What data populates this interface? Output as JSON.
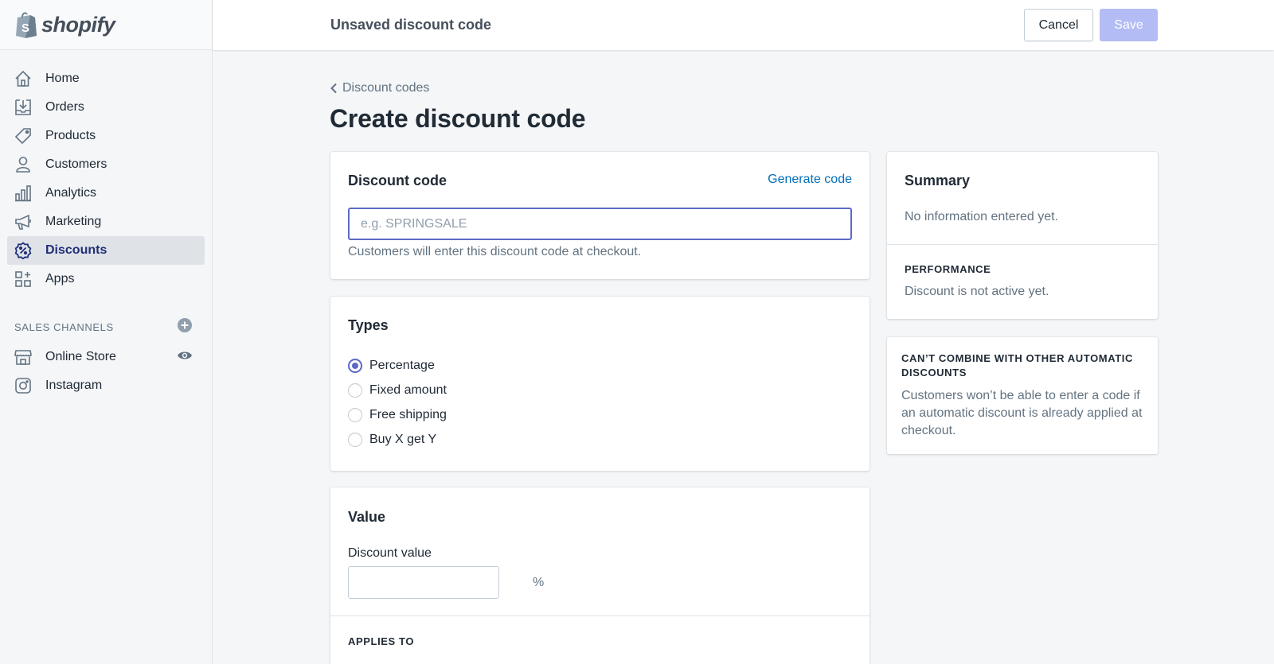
{
  "brand": {
    "name": "shopify"
  },
  "sidebar": {
    "items": [
      {
        "label": "Home",
        "icon": "home-icon"
      },
      {
        "label": "Orders",
        "icon": "orders-icon"
      },
      {
        "label": "Products",
        "icon": "tag-icon"
      },
      {
        "label": "Customers",
        "icon": "person-icon"
      },
      {
        "label": "Analytics",
        "icon": "bar-chart-icon"
      },
      {
        "label": "Marketing",
        "icon": "megaphone-icon"
      },
      {
        "label": "Discounts",
        "icon": "discount-icon",
        "active": true
      },
      {
        "label": "Apps",
        "icon": "apps-icon"
      }
    ],
    "sales_channels": {
      "heading": "SALES CHANNELS",
      "channels": [
        {
          "label": "Online Store",
          "icon": "store-icon"
        },
        {
          "label": "Instagram",
          "icon": "instagram-icon"
        }
      ]
    }
  },
  "topbar": {
    "title": "Unsaved discount code",
    "cancel_label": "Cancel",
    "save_label": "Save"
  },
  "page": {
    "breadcrumb": "Discount codes",
    "title": "Create discount code"
  },
  "discount_code_card": {
    "heading": "Discount code",
    "generate_label": "Generate code",
    "input_placeholder": "e.g. SPRINGSALE",
    "input_value": "",
    "help": "Customers will enter this discount code at checkout."
  },
  "types_card": {
    "heading": "Types",
    "options": [
      {
        "label": "Percentage",
        "selected": true
      },
      {
        "label": "Fixed amount",
        "selected": false
      },
      {
        "label": "Free shipping",
        "selected": false
      },
      {
        "label": "Buy X get Y",
        "selected": false
      }
    ]
  },
  "value_card": {
    "heading": "Value",
    "field_label": "Discount value",
    "suffix": "%",
    "applies_heading": "APPLIES TO"
  },
  "summary_card": {
    "heading": "Summary",
    "empty_text": "No information entered yet.",
    "performance_heading": "PERFORMANCE",
    "performance_text": "Discount is not active yet."
  },
  "combine_card": {
    "heading": "CAN’T COMBINE WITH OTHER AUTOMATIC DISCOUNTS",
    "body": "Customers won’t be able to enter a code if an automatic discount is already applied at checkout."
  },
  "colors": {
    "accent": "#5c6ac4",
    "link": "#006fbb",
    "save_disabled": "#b3bcf5",
    "active_nav_text": "#202e78"
  }
}
